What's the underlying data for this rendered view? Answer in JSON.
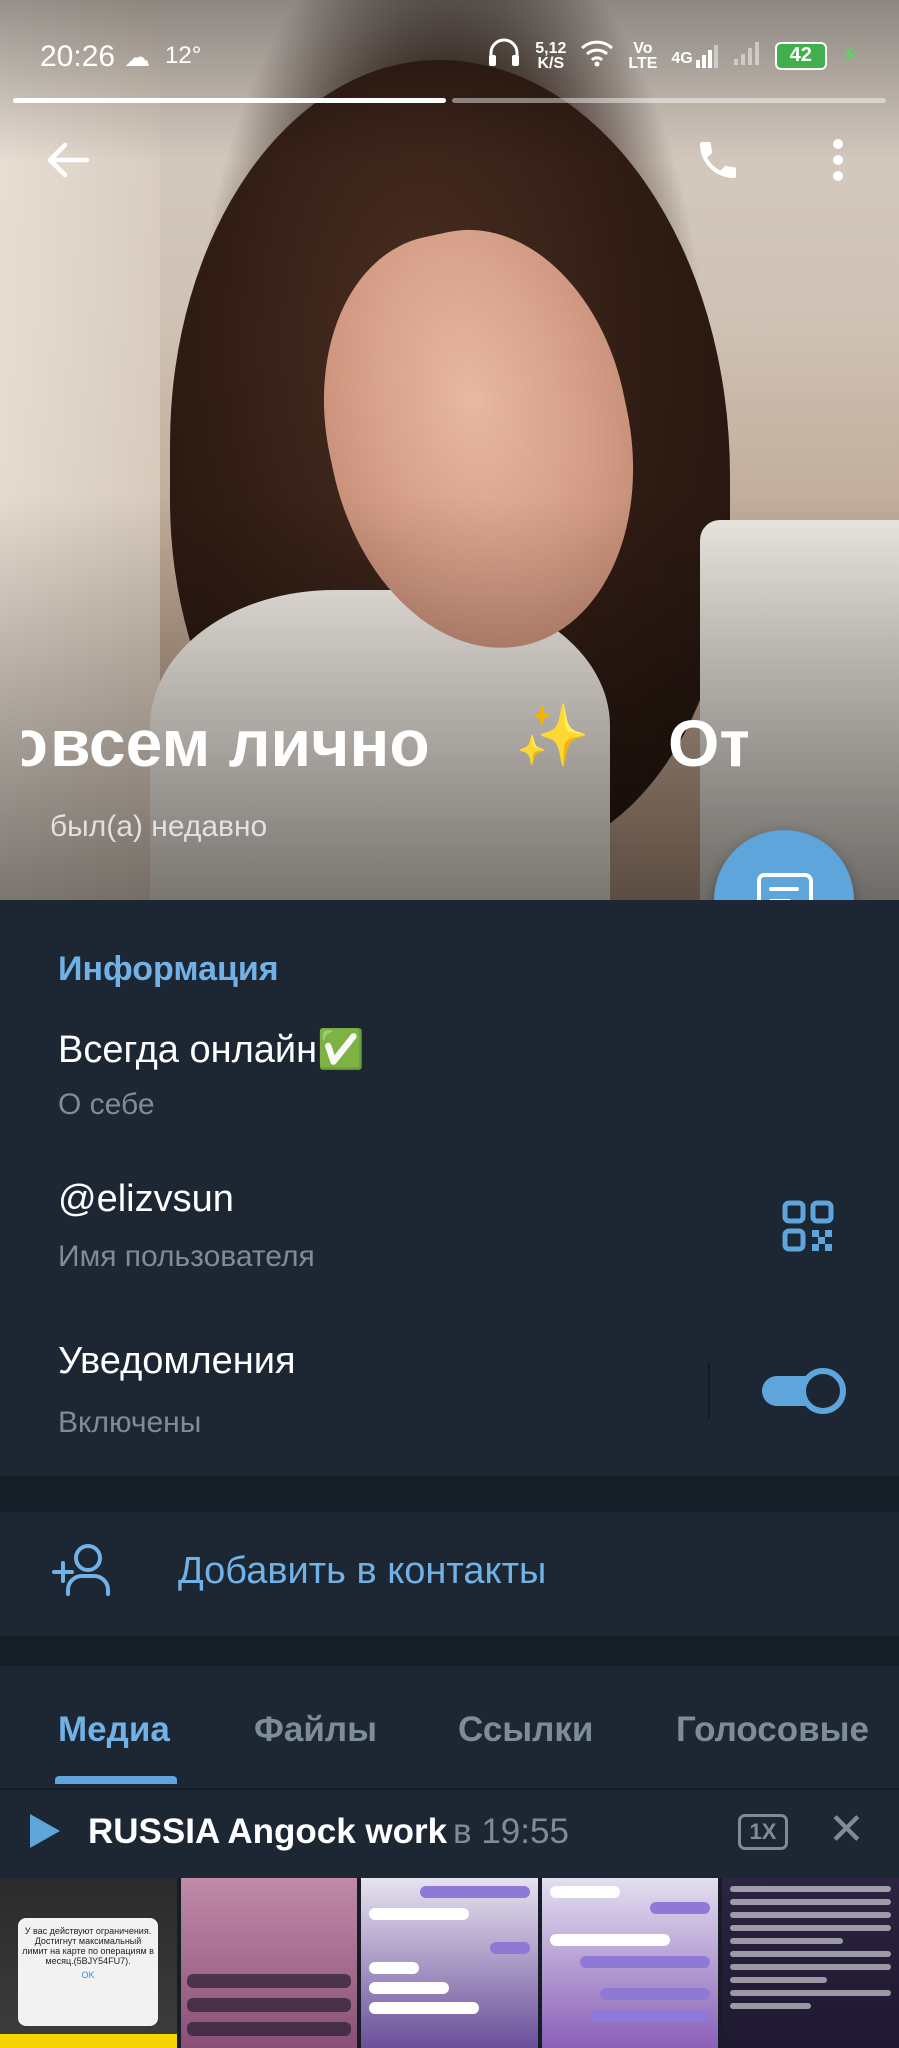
{
  "status_bar": {
    "time": "20:26",
    "temperature": "12°",
    "net_speed_value": "5,12",
    "net_speed_unit": "K/S",
    "volte_top": "Vo",
    "volte_bottom": "LTE",
    "network": "4G",
    "battery": "42"
  },
  "profile": {
    "name": "всем лично",
    "name_tail": "От",
    "name_lead": "о",
    "last_seen": "был(а) недавно"
  },
  "info": {
    "section_title": "Информация",
    "bio": "Всегда онлайн✅",
    "bio_label": "О себе",
    "username": "@elizvsun",
    "username_label": "Имя пользователя",
    "notifications": "Уведомления",
    "notifications_state": "Включены",
    "notifications_on": true
  },
  "add_contact": "Добавить в контакты",
  "tabs": [
    "Медиа",
    "Файлы",
    "Ссылки",
    "Голосовые"
  ],
  "active_tab": "Медиа",
  "player": {
    "title": "RUSSIA Angock work",
    "when": "в 19:55",
    "speed": "1X"
  },
  "media_thumbs": {
    "t1_text": "У вас действуют ограничения. Достигнут максимальный лимит на карте по операциям в месяц.(5BJY54FU7).",
    "t1_ok": "OK"
  },
  "colors": {
    "accent": "#5ea5dc",
    "link": "#71b1e6",
    "background": "#1d2733",
    "separator": "#151d26",
    "secondary_text": "#7e8b98"
  }
}
